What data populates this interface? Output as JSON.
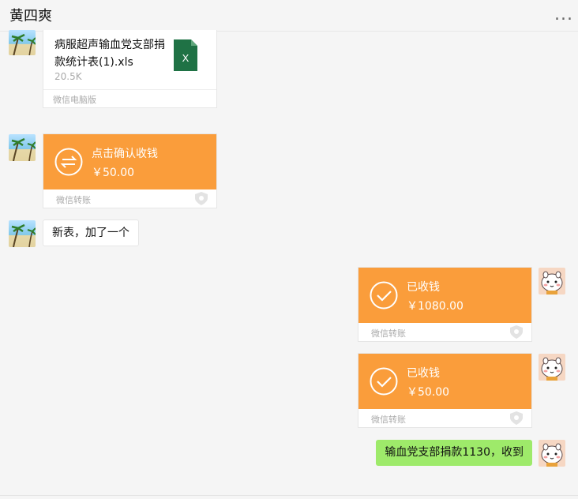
{
  "header": {
    "title": "黄四爽",
    "more_label": "..."
  },
  "messages": {
    "file": {
      "name": "病服超声输血党支部捐款统计表(1).xls",
      "size": "20.5K",
      "footer": "微信电脑版",
      "icon_letter": "X"
    },
    "transfer_1": {
      "title": "点击确认收钱",
      "amount": "￥50.00",
      "footer": "微信转账"
    },
    "text_1": {
      "text": "新表，加了一个"
    },
    "transfer_2": {
      "title": "已收钱",
      "amount": "￥1080.00",
      "footer": "微信转账"
    },
    "transfer_3": {
      "title": "已收钱",
      "amount": "￥50.00",
      "footer": "微信转账"
    },
    "text_2": {
      "text": "输血党支部捐款1130，收到"
    }
  },
  "colors": {
    "transfer_orange": "#fa9d3b",
    "self_bubble_green": "#9eea6a",
    "excel_green": "#1f7245"
  }
}
